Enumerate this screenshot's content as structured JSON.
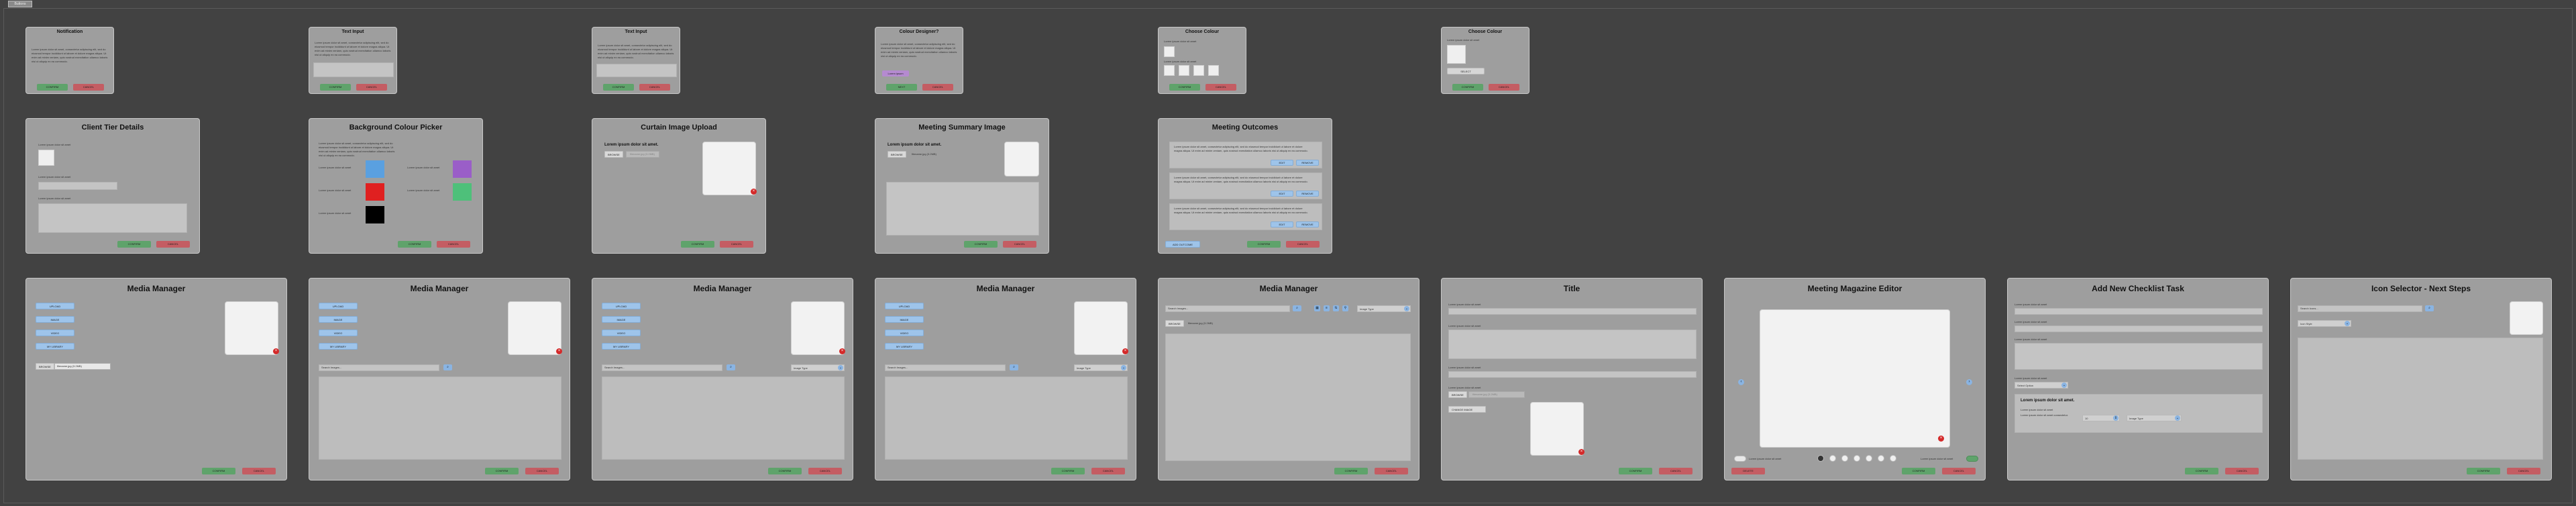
{
  "top_tag": "Buttons",
  "common": {
    "confirm": "CONFIRM",
    "cancel": "CANCEL",
    "lorem_short": "Lorem ipsum dolor sit amet",
    "lorem_line": "Lorem ipsum dolor sit amet consectetur.",
    "lorem_para": "Lorem ipsum dolor sit amet, consectetur adipiscing elit, sed do eiusmod tempor incididunt ut labore et dolore magna aliqua. Ut enim ad minim veniam, quis nostrud exercitation ullamco laboris nisi ut aliquip ex ea commodo.",
    "lorem_bold": "Lorem ipsum dolor sit amet.",
    "browse": "BROWSE",
    "file_name": "filename.jpg (3.2MB)",
    "search_placeholder": "Search Images...",
    "file_type": "Image Type",
    "edit": "EDIT",
    "remove": "REMOVE",
    "select": "SELECT"
  },
  "row1": {
    "notification": {
      "title": "Notification"
    },
    "text_input": {
      "title": "Text Input"
    },
    "text_input_2": {
      "title": "Text Input"
    },
    "colour_designer": {
      "title": "Colour Designer?",
      "chip": "Lorem ipsum",
      "next": "NEXT"
    },
    "choose_colour": {
      "title": "Choose Colour"
    },
    "choose_colour_2": {
      "title": "Choose Colour"
    }
  },
  "row2": {
    "client_tier": {
      "title": "Client Tier Details"
    },
    "bg_picker": {
      "title": "Background Colour Picker",
      "swatches": [
        "#5aa0e0",
        "#e02020",
        "#000000",
        "#9a5ec8",
        "#4ec07a"
      ]
    },
    "curtain_upload": {
      "title": "Curtain Image Upload"
    },
    "meeting_summary": {
      "title": "Meeting Summary Image"
    },
    "meeting_outcomes": {
      "title": "Meeting Outcomes",
      "add_outcome": "ADD OUTCOME"
    }
  },
  "row3": {
    "media_titles": [
      "Media Manager",
      "Media Manager",
      "Media Manager",
      "Media Manager",
      "Media Manager"
    ],
    "media_tabs": [
      "UPLOAD",
      "IMAGE",
      "VIDEO",
      "MY LIBRARY"
    ],
    "title_panel": {
      "title": "Title",
      "change_image": "CHANGE IMAGE"
    },
    "magazine": {
      "title": "Meeting Magazine Editor",
      "delete": "DELETE",
      "toggle_label": "Lorem ipsum dolor sit amet",
      "toggle_label_2": "Lorem ipsum dolor sit amet"
    },
    "checklist": {
      "title": "Add New Checklist Task",
      "select_label": "Select Option",
      "qty": "10"
    },
    "icon_selector": {
      "title": "Icon Selector - Next Steps",
      "search": "Search Icons...",
      "category": "Icon Style"
    }
  },
  "colors": {
    "background": "#424242",
    "card": "#9e9e9e",
    "confirm": "#5fa36b",
    "cancel": "#c45d63",
    "accent": "#9ec4ea"
  }
}
